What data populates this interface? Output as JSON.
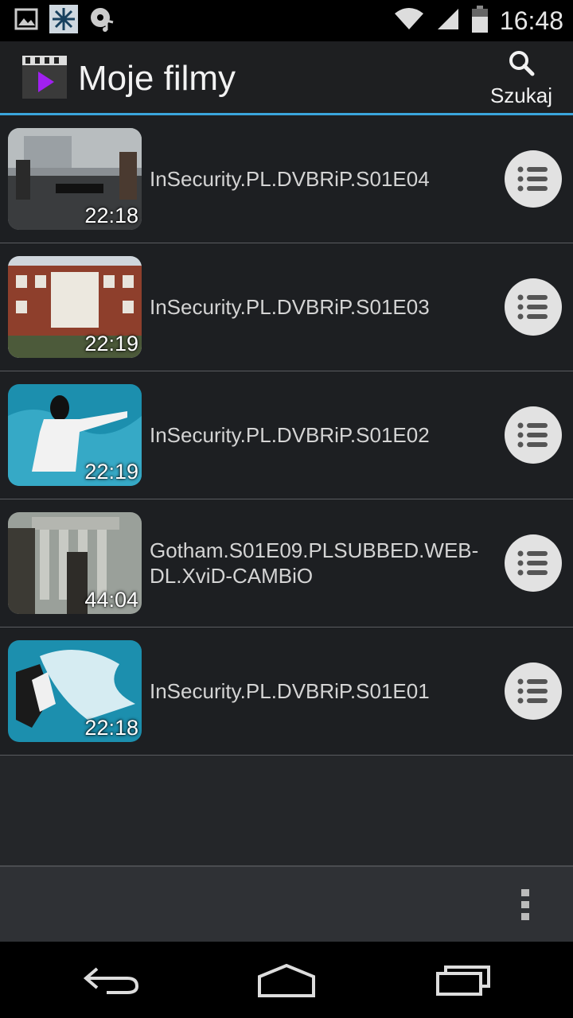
{
  "status_bar": {
    "time": "16:48",
    "left_icons": [
      "image-notification-icon",
      "snowflake-icon",
      "music-disc-icon"
    ],
    "right_icons": [
      "wifi-icon",
      "signal-icon",
      "battery-icon"
    ]
  },
  "action_bar": {
    "title": "Moje filmy",
    "search_label": "Szukaj"
  },
  "videos": [
    {
      "title": "InSecurity.PL.DVBRiP.S01E04",
      "duration": "22:18"
    },
    {
      "title": "InSecurity.PL.DVBRiP.S01E03",
      "duration": "22:19"
    },
    {
      "title": "InSecurity.PL.DVBRiP.S01E02",
      "duration": "22:19"
    },
    {
      "title": "Gotham.S01E09.PLSUBBED.WEB-DL.XviD-CAMBiO",
      "duration": "44:04"
    },
    {
      "title": "InSecurity.PL.DVBRiP.S01E01",
      "duration": "22:18"
    }
  ],
  "colors": {
    "accent": "#3aa5dc",
    "app_icon_play": "#a020f0"
  }
}
